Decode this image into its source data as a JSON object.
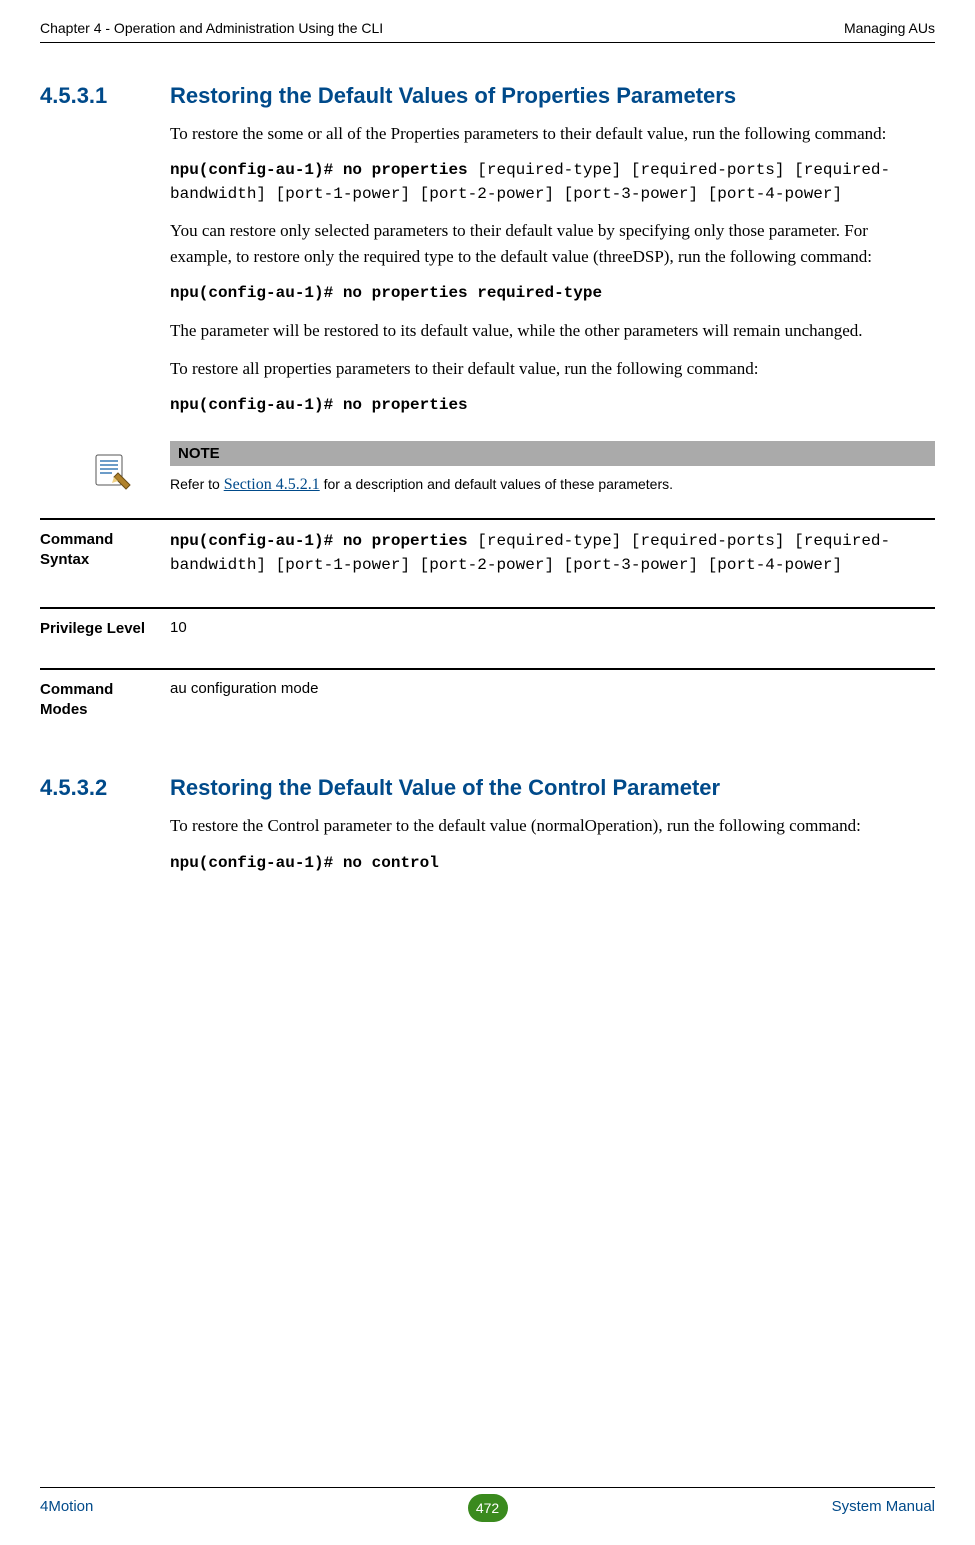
{
  "header": {
    "left": "Chapter 4 - Operation and Administration Using the CLI",
    "right": "Managing AUs"
  },
  "section1": {
    "num": "4.5.3.1",
    "title": "Restoring the Default Values of Properties Parameters",
    "p1": "To restore the some or all of the Properties parameters to their default value, run the following command:",
    "cmd1_bold": "npu(config-au-1)# no properties",
    "cmd1_rest": " [required-type] [required-ports] [required-bandwidth] [port-1-power] [port-2-power] [port-3-power] [port-4-power]",
    "p2": "You can restore only selected parameters to their default value by specifying only those parameter. For example, to restore only the required type to the default value (threeDSP), run the following command:",
    "cmd2": "npu(config-au-1)# no properties required-type",
    "p3": "The parameter will be restored to its default value, while the other parameters will remain unchanged.",
    "p4": "To restore all properties parameters to their default value, run the following command:",
    "cmd3": "npu(config-au-1)# no properties"
  },
  "note": {
    "title": "NOTE",
    "text_before": "Refer to ",
    "link": "Section 4.5.2.1",
    "text_after": " for a description and default values of these parameters."
  },
  "kv": {
    "syntax_label": "Command Syntax",
    "syntax_bold": "npu(config-au-1)# no properties",
    "syntax_rest": " [required-type] [required-ports] [required-bandwidth] [port-1-power] [port-2-power] [port-3-power] [port-4-power]",
    "priv_label": "Privilege Level",
    "priv_value": "10",
    "modes_label": "Command Modes",
    "modes_value": "au configuration mode"
  },
  "section2": {
    "num": "4.5.3.2",
    "title": "Restoring the Default Value of the Control Parameter",
    "p1": "To restore the Control parameter to the default value (normalOperation), run the following command:",
    "cmd1": "npu(config-au-1)# no control"
  },
  "footer": {
    "left": "4Motion",
    "page": "472",
    "right": "System Manual"
  }
}
